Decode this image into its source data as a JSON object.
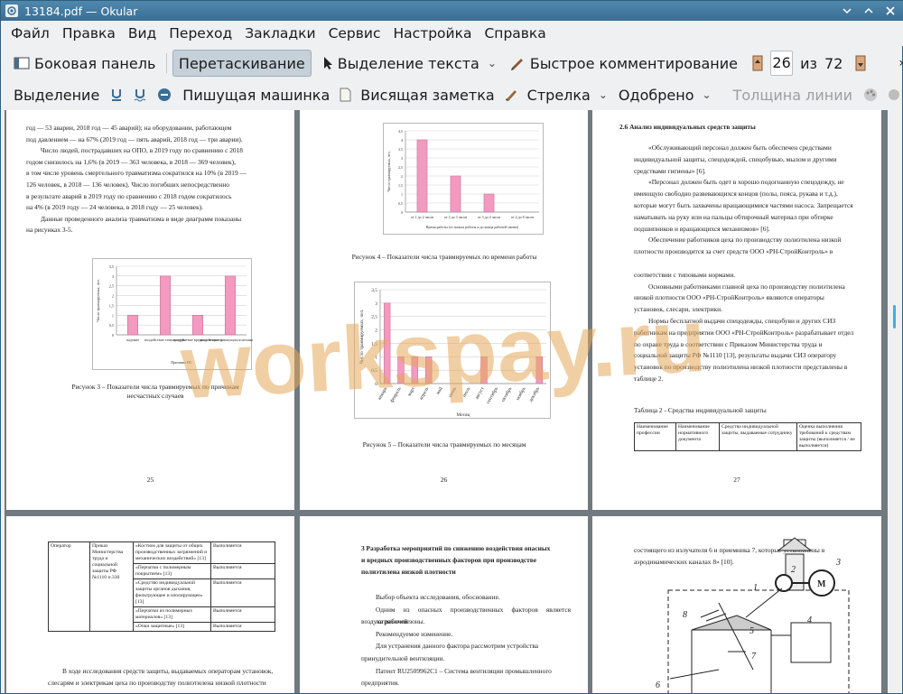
{
  "window": {
    "title": "13184.pdf — Okular"
  },
  "menu": [
    "Файл",
    "Правка",
    "Вид",
    "Переход",
    "Закладки",
    "Сервис",
    "Настройка",
    "Справка"
  ],
  "toolbar1": {
    "sidebar": "Боковая панель",
    "drag": "Перетаскивание",
    "text_select": "Выделение текста",
    "quick_comment": "Быстрое комментирование",
    "page_current": "26",
    "page_of": "из",
    "page_total": "72"
  },
  "toolbar2": {
    "highlight": "Выделение",
    "typewriter": "Пишущая машинка",
    "popup_note": "Висящая заметка",
    "arrow": "Стрелка",
    "approved": "Одобрено",
    "line_width": "Толщина линии"
  },
  "colors": {
    "accent": "#3daee9",
    "titlebar": "#4a80a5",
    "bar": "#f29ac0"
  },
  "watermark": "workspay.ru",
  "pages": {
    "p25": {
      "number": "25",
      "lines": [
        "год — 53 аварии, 2018 год — 45 аварий); на оборудовании, работающем",
        "под давлением — на 67% (2019 год — пять аварий, 2018 год — три аварии).",
        "Число людей, пострадавших на ОПО, в 2019 году по сравнению с 2018",
        "годом снизилось на 1,6% (в 2019 — 363 человека, в 2018 — 369 человек),",
        "в том числе уровень смертельного травматизма сократился на 10% (в 2019 —",
        "126 человек, в 2018 — 136 человек). Число погибших непосредственно",
        "в результате аварий в 2019 году по сравнению с 2018 годом сократилось",
        "на 4% (в 2019 году — 24 человека, в 2018 году — 25 человек).",
        "Данные проведенного анализа травматизма в виде диаграмм показаны",
        "на рисунках 3-5."
      ],
      "caption": "Рисунок 3 – Показатели числа травмируемых по причинам несчастных случаев"
    },
    "p26": {
      "number": "26",
      "caption4": "Рисунок 4 – Показатели числа травмируемых по времени работы",
      "caption5": "Рисунок 5 – Показатели числа травмируемых по месяцам"
    },
    "p27": {
      "number": "27",
      "heading": "2.6 Анализ индивидуальных средств защиты",
      "lines": [
        "«Обслуживающий персонал должен быть обеспечен средствами",
        "индивидуальной защиты, спецодеждой, спецобувью, мылом и другими",
        "средствами гигиены» [6].",
        "«Персонал должен быть одет в хорошо подогнанную спецодежду, не",
        "имеющую свободно развевающихся концов (полы, пояса, рукава и т.д.),",
        "которые могут быть захвачены вращающимися частями насоса. Запрещается",
        "наматывать на руку или на пальцы обтирочный материал при обтирке",
        "подшипников и вращающихся механизмов» [6].",
        "Обеспечение работников цеха по производству полиэтилена низкой",
        "плотности производится за счет средств ООО «РН-СтройКонтроль» в",
        "",
        "соответствии с типовыми нормами.",
        "Основными работниками главной цеха по производству полиэтилена",
        "низкой плотности ООО «РН-СтройКонтроль» являются операторы",
        "установок, слесари, электрики.",
        "Нормы бесплатной выдачи спецодежды, спецобуви и других СИЗ",
        "работникам на предприятии ООО «РН-СтройКонтроль» разрабатывает отдел",
        "по охране труда в соответствии с Приказом Министерства труда и",
        "социальной защиты РФ №1110 [13], результаты выдачи СИЗ оператору",
        "установок по производству полиэтилена низкой плотности представлены в",
        "таблице 2."
      ],
      "table_caption": "Таблица 2 - Средства индивидуальной защиты",
      "table_head": [
        "Наименование профессии",
        "Наименование нормативного документа",
        "Средства индивидуальной защиты, выдаваемые сотруднику",
        "Оценка выполнения требований к средствам защиты (выполняется / не выполняется)"
      ]
    },
    "p28": {
      "rows": [
        [
          "Оператор",
          "Приказ Министерства труда и социальной защиты РФ №1110 п.330",
          "«Костюм для защиты от общих производственных загрязнений и механических воздействий» [13]",
          "Выполняется"
        ],
        [
          "",
          "",
          "«Перчатки с полимерным покрытием» [13]",
          "Выполняется"
        ],
        [
          "",
          "",
          "«Средство индивидуальной защиты органов дыхания, фильтрующее и изолирующее» [13]",
          "Выполняется"
        ],
        [
          "",
          "",
          "«Перчатки из полимерных материалов» [13]",
          "Выполняется"
        ],
        [
          "",
          "",
          "«Очки защитные» [13]",
          "Выполняется"
        ]
      ],
      "lines": [
        "В ходе исследования средств защиты, выдаваемых операторам установок,",
        "слесарям и электрикам цеха по производству полиэтилена низкой плотности"
      ]
    },
    "p29": {
      "heading": [
        "3 Разработка мероприятий по снижению воздействия опасных",
        "и вредных производственных факторов при производстве",
        "полиэтилена низкой плотности"
      ],
      "lines": [
        "Выбор объекта исследования, обоснование.",
        "Одним из опасных производственных факторов является загрязнение",
        "воздуха рабочей зоны.",
        "Рекомендуемое изменение.",
        "Для устранения данного фактора рассмотрим устройства",
        "принудительной вентиляции.",
        "Патент RU2509962C1 – Система вентиляции промышленного",
        "предприятия."
      ]
    },
    "p30": {
      "lines": [
        "состоящего из излучателя 6 и приемника 7, которые установлены в",
        "аэродинамических каналах 8» [10]."
      ],
      "labels": [
        "1",
        "2",
        "3",
        "M",
        "4",
        "5",
        "6",
        "7",
        "8"
      ]
    }
  },
  "chart_data": [
    {
      "type": "bar",
      "ylabel": "Число травмируемых, чел.",
      "xlabel": "Причины НС",
      "categories": [
        "падение",
        "воздействие температуры",
        "воздействие вредных веществ",
        "воздействие движущихся механизмов"
      ],
      "values": [
        1,
        3,
        1,
        3
      ],
      "ylim": [
        0,
        3.5
      ],
      "yticks": [
        "0",
        "0,5",
        "1",
        "1,5",
        "2",
        "2,5",
        "3",
        "3,5"
      ]
    },
    {
      "type": "bar",
      "ylabel": "Число травмируемых, чел.",
      "xlabel": "Время работы (от начала работы и до конца рабочей смены)",
      "categories": [
        "от 1 до 2 часов",
        "от 2 до 3 часов",
        "от 3 до 4 часов",
        "от 4 до 8 часов"
      ],
      "values": [
        4,
        2,
        1,
        0
      ],
      "ylim": [
        0,
        4.5
      ],
      "yticks": [
        "0",
        "0,5",
        "1",
        "1,5",
        "2",
        "2,5",
        "3",
        "3,5",
        "4",
        "4,5"
      ]
    },
    {
      "type": "bar",
      "ylabel": "Число травмируемых, чел.",
      "xlabel": "Месяц",
      "categories": [
        "январь",
        "февраль",
        "март",
        "апрель",
        "май",
        "июнь",
        "июль",
        "август",
        "сентябрь",
        "октябрь",
        "ноябрь",
        "декабрь"
      ],
      "values": [
        3,
        1,
        1,
        1,
        0,
        0,
        0,
        1,
        0,
        0,
        0,
        1
      ],
      "ylim": [
        0,
        3.5
      ],
      "yticks": [
        "0",
        "0,5",
        "1",
        "1,5",
        "2",
        "2,5",
        "3",
        "3,5"
      ]
    }
  ]
}
